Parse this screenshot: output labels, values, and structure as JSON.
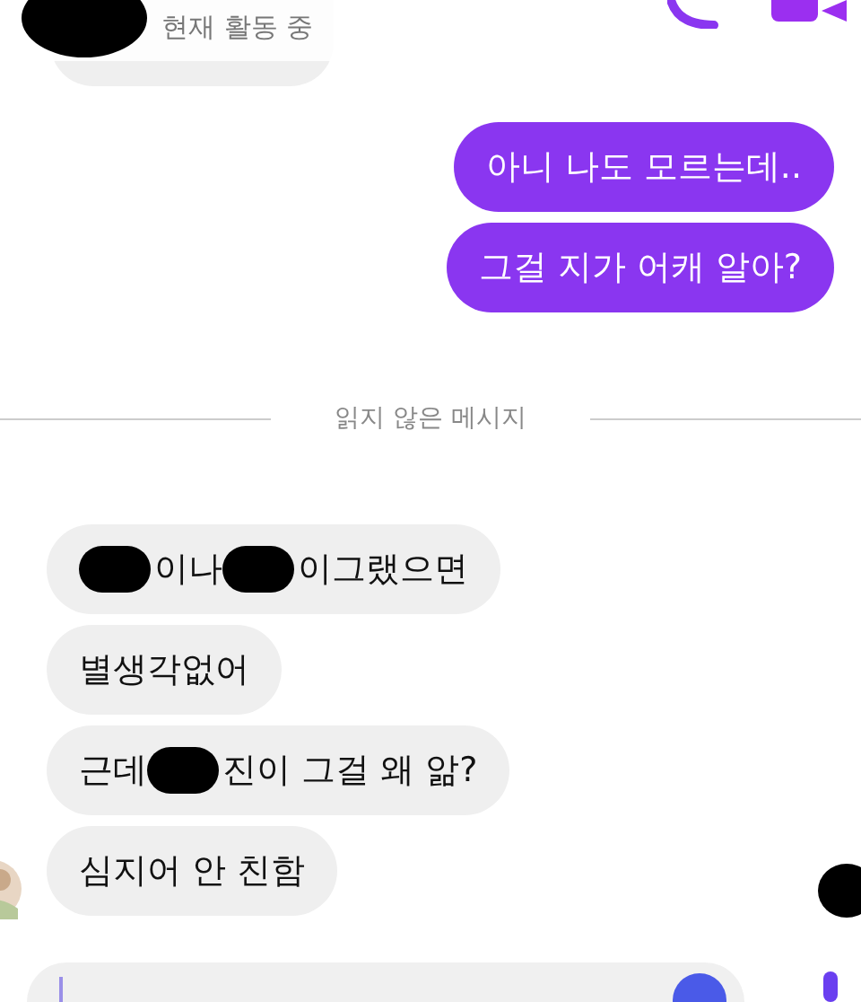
{
  "header": {
    "status": "현재 활동 중"
  },
  "messages": [
    {
      "kind": "sent",
      "segments": [
        {
          "kind": "text",
          "text": "아니 나도 모르는데.."
        }
      ]
    },
    {
      "kind": "sent",
      "segments": [
        {
          "kind": "text",
          "text": "그걸 지가 어캐 알아?"
        }
      ]
    },
    {
      "kind": "divider",
      "segments": [
        {
          "kind": "text",
          "text": "읽지 않은 메시지"
        }
      ]
    },
    {
      "kind": "received",
      "segments": [
        {
          "kind": "redaction"
        },
        {
          "kind": "text",
          "text": "이나 "
        },
        {
          "kind": "redaction"
        },
        {
          "kind": "text",
          "text": "이그랬으면"
        }
      ]
    },
    {
      "kind": "received",
      "segments": [
        {
          "kind": "text",
          "text": "별생각없어"
        }
      ]
    },
    {
      "kind": "received",
      "segments": [
        {
          "kind": "text",
          "text": "근데 "
        },
        {
          "kind": "redaction"
        },
        {
          "kind": "text",
          "text": "진이 그걸 왜 앎?"
        }
      ]
    },
    {
      "kind": "received",
      "segments": [
        {
          "kind": "text",
          "text": "심지어 안 친함"
        }
      ]
    }
  ]
}
